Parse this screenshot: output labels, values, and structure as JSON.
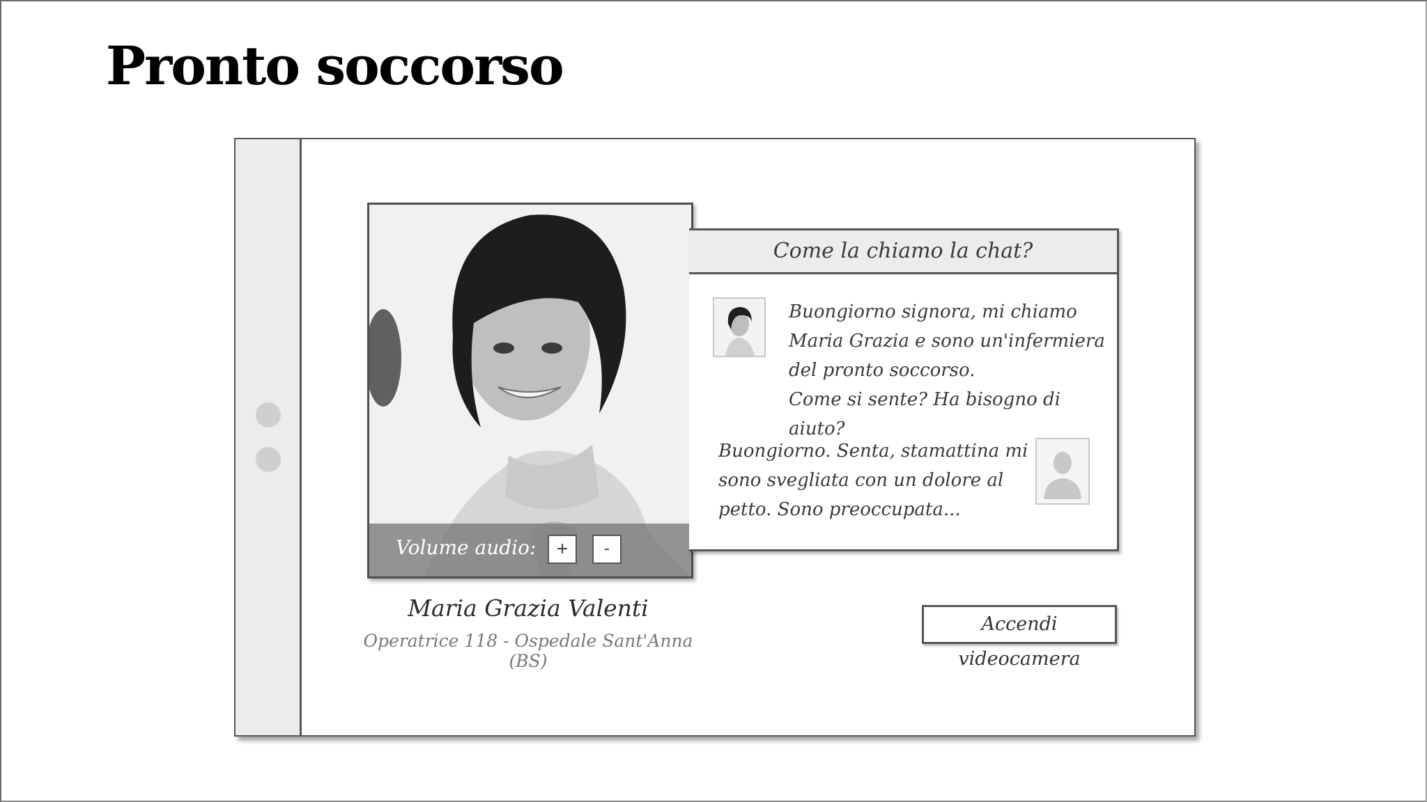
{
  "slide": {
    "title": "Pronto soccorso"
  },
  "video": {
    "volume_label": "Volume audio:",
    "volume_up_label": "+",
    "volume_down_label": "-"
  },
  "operator": {
    "name": "Maria Grazia Valenti",
    "role": "Operatrice 118 - Ospedale Sant'Anna (BS)"
  },
  "chat": {
    "header": "Come la chiamo la chat?",
    "messages": [
      {
        "sender": "operator",
        "text": "Buongiorno signora, mi chiamo\nMaria Grazia e sono un'infermiera\ndel pronto soccorso.\nCome si sente? Ha bisogno di aiuto?"
      },
      {
        "sender": "user",
        "text": "Buongiorno. Senta, stamattina mi\nsono svegliata con un dolore al\npetto. Sono preoccupata..."
      }
    ]
  },
  "actions": {
    "camera_button": "Accendi videocamera"
  }
}
